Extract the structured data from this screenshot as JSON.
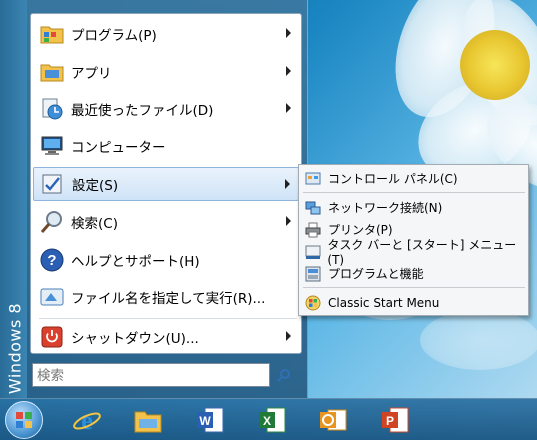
{
  "start_menu": {
    "banner": "Windows 8",
    "items": [
      {
        "label": "プログラム(P)",
        "icon": "programs-folder-icon"
      },
      {
        "label": "アプリ",
        "icon": "apps-folder-icon"
      },
      {
        "label": "最近使ったファイル(D)",
        "icon": "recent-files-icon"
      },
      {
        "label": "コンピューター",
        "icon": "computer-icon"
      },
      {
        "label": "設定(S)",
        "icon": "settings-icon"
      },
      {
        "label": "検索(C)",
        "icon": "search-magnifier-icon"
      },
      {
        "label": "ヘルプとサポート(H)",
        "icon": "help-icon"
      },
      {
        "label": "ファイル名を指定して実行(R)...",
        "icon": "run-icon"
      },
      {
        "label": "シャットダウン(U)...",
        "icon": "shutdown-icon"
      }
    ],
    "search_placeholder": "検索"
  },
  "settings_submenu": {
    "items": [
      {
        "label": "コントロール パネル(C)",
        "icon": "control-panel-icon"
      },
      {
        "label": "ネットワーク接続(N)",
        "icon": "network-connections-icon"
      },
      {
        "label": "プリンタ(P)",
        "icon": "printer-icon"
      },
      {
        "label": "タスク バーと [スタート] メニュー(T)",
        "icon": "taskbar-start-menu-icon"
      },
      {
        "label": "プログラムと機能",
        "icon": "programs-features-icon"
      },
      {
        "label": "Classic Start Menu",
        "icon": "classic-start-menu-icon"
      }
    ]
  },
  "taskbar": {
    "apps": [
      "internet-explorer-icon",
      "file-explorer-icon",
      "word-icon",
      "excel-icon",
      "outlook-icon",
      "powerpoint-icon"
    ]
  },
  "colors": {
    "selection_bg": "#cfe3f7",
    "selection_border": "#8fb5dd",
    "menu_shell": "#3c78a0",
    "taskbar": "#286ea0"
  }
}
